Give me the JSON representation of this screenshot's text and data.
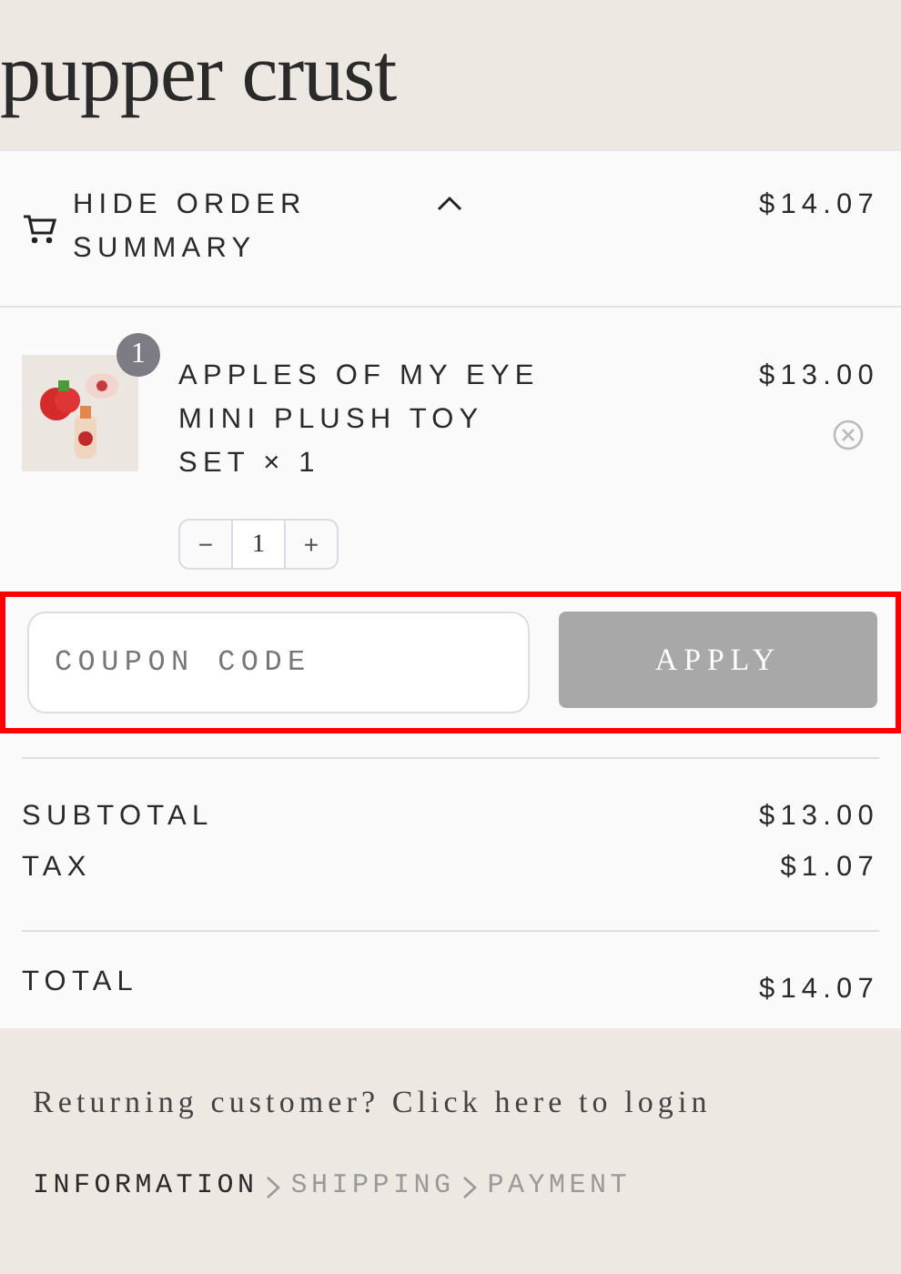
{
  "logo": "pupper crust",
  "summary": {
    "toggle": "HIDE ORDER SUMMARY",
    "expanded": true,
    "total": "$14.07"
  },
  "items": [
    {
      "name": "APPLES OF MY EYE MINI PLUSH TOY SET",
      "times": "× 1",
      "badge": "1",
      "price": "$13.00",
      "minus": "−",
      "quantity": "1",
      "plus": "+"
    }
  ],
  "coupon": {
    "placeholder": "COUPON CODE",
    "button": "APPLY",
    "disabled": true,
    "highlighted": true
  },
  "lines": [
    {
      "label": "SUBTOTAL",
      "value": "$13.00"
    },
    {
      "label": "TAX",
      "value": "$1.07"
    }
  ],
  "total": {
    "label": "TOTAL",
    "value": "$14.07"
  },
  "login": "Returning customer? Click here to login",
  "steps": [
    {
      "label": "INFORMATION",
      "selected": true
    },
    {
      "label": "SHIPPING",
      "selected": false
    },
    {
      "label": "PAYMENT",
      "selected": false
    }
  ]
}
